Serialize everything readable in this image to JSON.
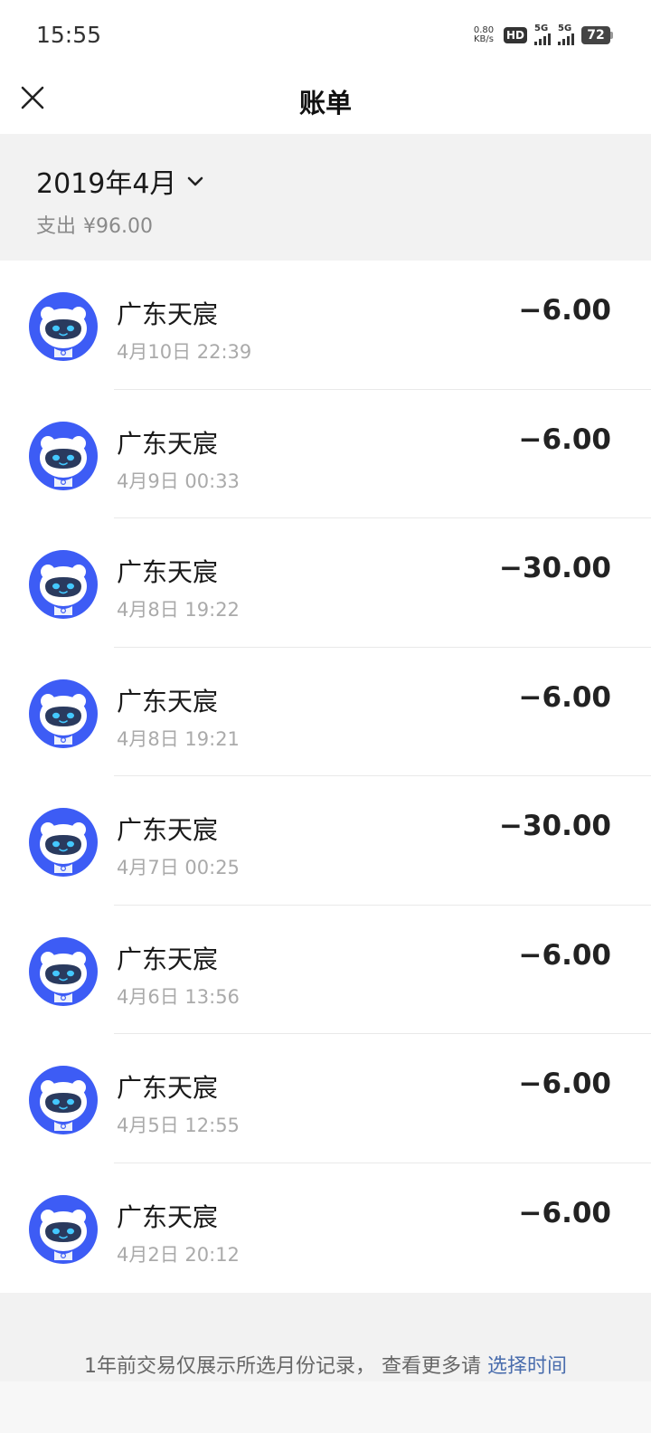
{
  "status_bar": {
    "time": "15:55",
    "net_speed_value": "0.80",
    "net_speed_unit": "KB/s",
    "hd_label": "HD",
    "signal1_label": "5G",
    "signal2_label": "5G",
    "battery": "72"
  },
  "header": {
    "close_icon": "close-icon",
    "title": "账单"
  },
  "month": {
    "label": "2019年4月",
    "expense_label": "支出",
    "expense_amount": "¥96.00"
  },
  "transactions": [
    {
      "name": "广东天宸",
      "time": "4月10日 22:39",
      "amount": "−6.00"
    },
    {
      "name": "广东天宸",
      "time": "4月9日 00:33",
      "amount": "−6.00"
    },
    {
      "name": "广东天宸",
      "time": "4月8日 19:22",
      "amount": "−30.00"
    },
    {
      "name": "广东天宸",
      "time": "4月8日 19:21",
      "amount": "−6.00"
    },
    {
      "name": "广东天宸",
      "time": "4月7日 00:25",
      "amount": "−30.00"
    },
    {
      "name": "广东天宸",
      "time": "4月6日 13:56",
      "amount": "−6.00"
    },
    {
      "name": "广东天宸",
      "time": "4月5日 12:55",
      "amount": "−6.00"
    },
    {
      "name": "广东天宸",
      "time": "4月2日 20:12",
      "amount": "−6.00"
    }
  ],
  "footer": {
    "text": "1年前交易仅展示所选月份记录， 查看更多请 ",
    "link": "选择时间"
  },
  "colors": {
    "avatar_blue": "#3d5cf5",
    "link": "#4a6dad",
    "section_bg": "#f2f2f2"
  }
}
